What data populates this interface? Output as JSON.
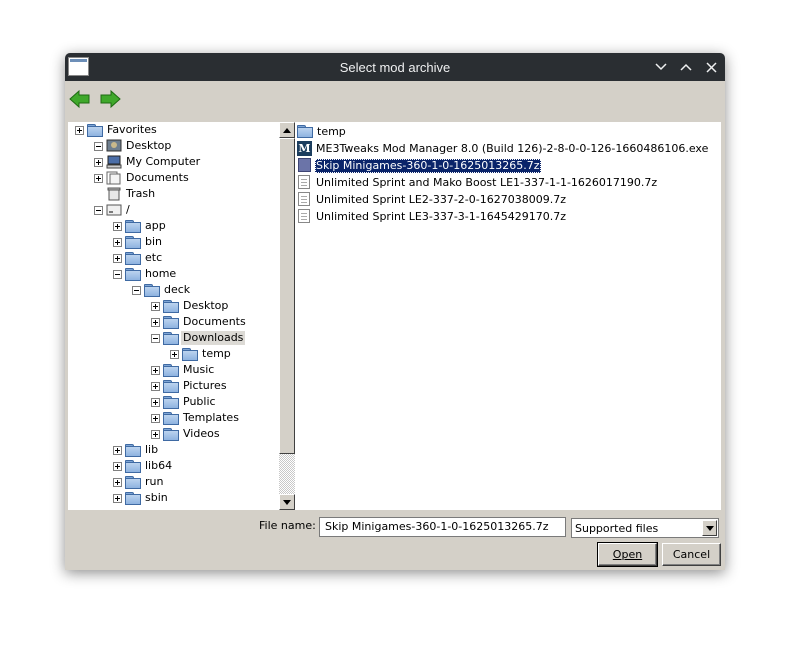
{
  "window": {
    "title": "Select mod archive"
  },
  "titlebar_icons": [
    "app-icon",
    "chevron-down-icon",
    "chevron-up-icon",
    "close-icon"
  ],
  "toolbar": {
    "back_icon": "back-arrow-icon",
    "forward_icon": "forward-arrow-icon"
  },
  "tree": {
    "items": [
      {
        "label": "Favorites",
        "exp": "plus",
        "icon": "folder-icon"
      },
      {
        "label": "Desktop",
        "exp": "minus",
        "icon": "desktop-icon"
      },
      {
        "label": "My Computer",
        "exp": "plus",
        "icon": "computer-icon"
      },
      {
        "label": "Documents",
        "exp": "plus",
        "icon": "documents-icon"
      },
      {
        "label": "Trash",
        "exp": "none",
        "icon": "trash-icon"
      },
      {
        "label": "/",
        "exp": "minus",
        "icon": "drive-icon"
      },
      {
        "label": "app",
        "exp": "plus",
        "icon": "folder-icon"
      },
      {
        "label": "bin",
        "exp": "plus",
        "icon": "folder-icon"
      },
      {
        "label": "etc",
        "exp": "plus",
        "icon": "folder-icon"
      },
      {
        "label": "home",
        "exp": "minus",
        "icon": "folder-icon"
      },
      {
        "label": "deck",
        "exp": "minus",
        "icon": "folder-icon"
      },
      {
        "label": "Desktop",
        "exp": "plus",
        "icon": "folder-icon"
      },
      {
        "label": "Documents",
        "exp": "plus",
        "icon": "folder-icon"
      },
      {
        "label": "Downloads",
        "exp": "minus",
        "icon": "folder-icon",
        "selected": true
      },
      {
        "label": "temp",
        "exp": "plus",
        "icon": "folder-icon"
      },
      {
        "label": "Music",
        "exp": "plus",
        "icon": "folder-icon"
      },
      {
        "label": "Pictures",
        "exp": "plus",
        "icon": "folder-icon"
      },
      {
        "label": "Public",
        "exp": "plus",
        "icon": "folder-icon"
      },
      {
        "label": "Templates",
        "exp": "plus",
        "icon": "folder-icon"
      },
      {
        "label": "Videos",
        "exp": "plus",
        "icon": "folder-icon"
      },
      {
        "label": "lib",
        "exp": "plus",
        "icon": "folder-icon"
      },
      {
        "label": "lib64",
        "exp": "plus",
        "icon": "folder-icon"
      },
      {
        "label": "run",
        "exp": "plus",
        "icon": "folder-icon"
      },
      {
        "label": "sbin",
        "exp": "plus",
        "icon": "folder-icon"
      }
    ]
  },
  "files": {
    "items": [
      {
        "name": "temp",
        "icon": "folder-icon"
      },
      {
        "name": "ME3Tweaks Mod Manager 8.0 (Build 126)-2-8-0-0-126-1660486106.exe",
        "icon": "me3tweaks-icon"
      },
      {
        "name": "Skip Minigames-360-1-0-1625013265.7z",
        "icon": "archive-icon",
        "selected": true
      },
      {
        "name": "Unlimited Sprint and Mako Boost LE1-337-1-1-1626017190.7z",
        "icon": "document-icon"
      },
      {
        "name": "Unlimited Sprint LE2-337-2-0-1627038009.7z",
        "icon": "document-icon"
      },
      {
        "name": "Unlimited Sprint LE3-337-3-1-1645429170.7z",
        "icon": "document-icon"
      }
    ]
  },
  "footer": {
    "filename_label": "File name:",
    "filename_value": "Skip Minigames-360-1-0-1625013265.7z",
    "filter_value": "Supported files",
    "open_label": "Open",
    "cancel_label": "Cancel"
  },
  "colors": {
    "titlebar": "#2a2e32",
    "dialog_bg": "#d4d0c8",
    "selection": "#0a246a",
    "arrow_green": "#3fa82b"
  }
}
